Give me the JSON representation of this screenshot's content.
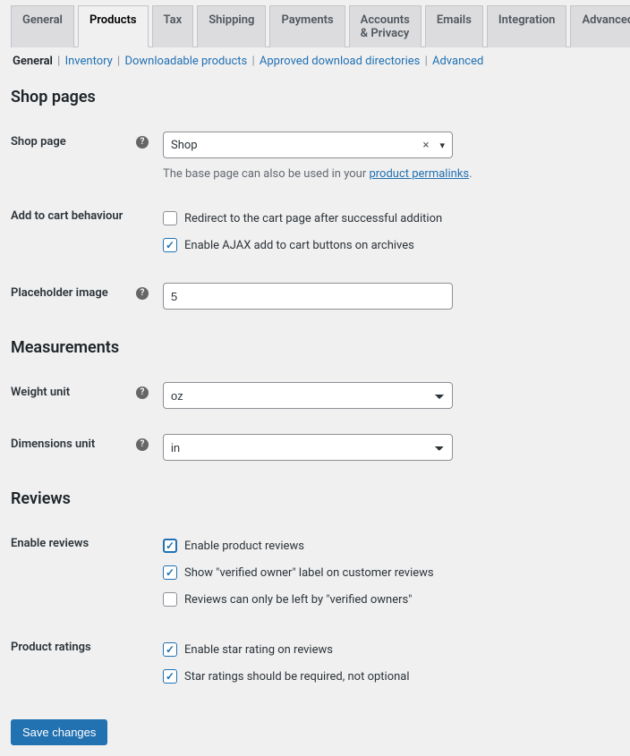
{
  "tabs": {
    "general": "General",
    "products": "Products",
    "tax": "Tax",
    "shipping": "Shipping",
    "payments": "Payments",
    "accounts": "Accounts & Privacy",
    "emails": "Emails",
    "integration": "Integration",
    "advanced": "Advanced"
  },
  "subtabs": {
    "general": "General",
    "inventory": "Inventory",
    "downloadable": "Downloadable products",
    "approved": "Approved download directories",
    "advanced": "Advanced"
  },
  "sections": {
    "shop_pages": "Shop pages",
    "measurements": "Measurements",
    "reviews": "Reviews"
  },
  "labels": {
    "shop_page": "Shop page",
    "add_to_cart": "Add to cart behaviour",
    "placeholder_image": "Placeholder image",
    "weight_unit": "Weight unit",
    "dimensions_unit": "Dimensions unit",
    "enable_reviews": "Enable reviews",
    "product_ratings": "Product ratings"
  },
  "shop_page": {
    "value": "Shop",
    "desc_prefix": "The base page can also be used in your ",
    "desc_link": "product permalinks",
    "desc_suffix": "."
  },
  "cart": {
    "redirect": "Redirect to the cart page after successful addition",
    "ajax": "Enable AJAX add to cart buttons on archives"
  },
  "placeholder_image_value": "5",
  "weight_unit_value": "oz",
  "dimensions_unit_value": "in",
  "reviews": {
    "enable": "Enable product reviews",
    "verified_label": "Show \"verified owner\" label on customer reviews",
    "verified_only": "Reviews can only be left by \"verified owners\""
  },
  "ratings": {
    "enable_star": "Enable star rating on reviews",
    "required": "Star ratings should be required, not optional"
  },
  "save_button": "Save changes"
}
